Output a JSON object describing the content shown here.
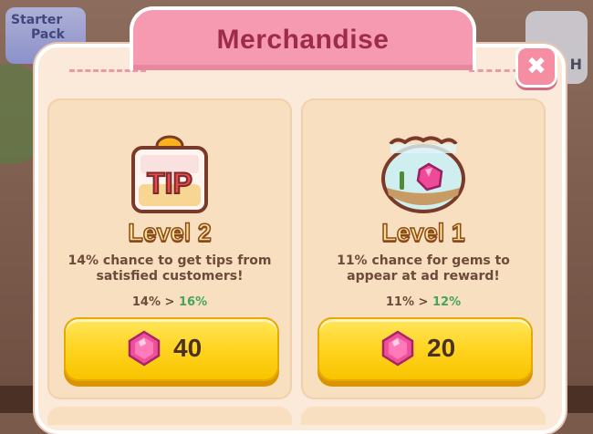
{
  "background": {
    "left_badge_line1": "Starter",
    "left_badge_line2": "Pack",
    "right_badge_text": "H"
  },
  "modal": {
    "title": "Merchandise",
    "close_symbol": "✖"
  },
  "items": [
    {
      "icon": "tip-jar-icon",
      "level": "Level 2",
      "description_line1": "14% chance to get tips from",
      "description_line2": "satisfied customers!",
      "current": "14%",
      "arrow": ">",
      "next": "16%",
      "price": "40",
      "currency_icon": "pink-gem-icon"
    },
    {
      "icon": "gem-fishbowl-icon",
      "level": "Level 1",
      "description_line1": "11% chance for gems to",
      "description_line2": "appear at ad reward!",
      "current": "11%",
      "arrow": ">",
      "next": "12%",
      "price": "20",
      "currency_icon": "pink-gem-icon"
    }
  ],
  "colors": {
    "title_tab": "#f59ab0",
    "title_text": "#9d2b4a",
    "button_yellow": "#ffd21c",
    "next_value_green": "#43a55a"
  }
}
